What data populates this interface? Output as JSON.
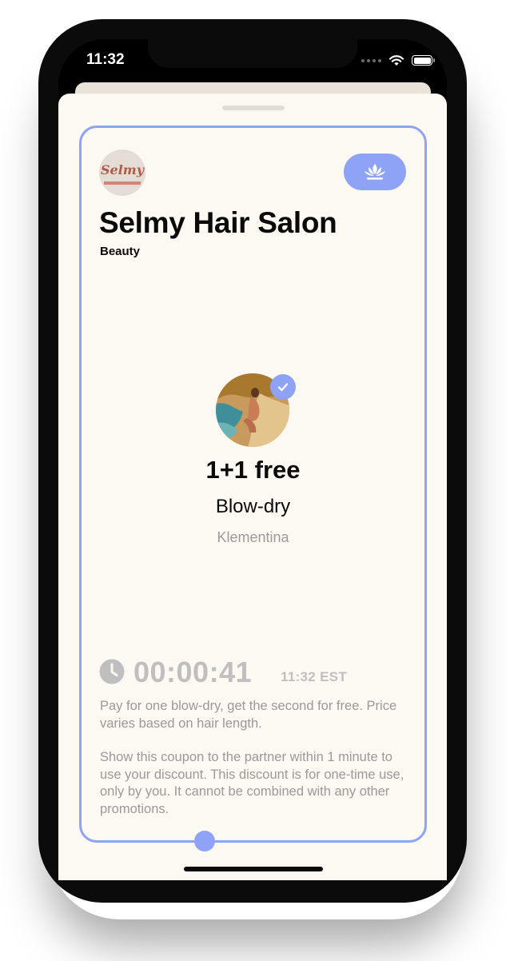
{
  "status_bar": {
    "time": "11:32",
    "icons": [
      "cellular-signal-icon",
      "wifi-icon",
      "battery-icon"
    ]
  },
  "partner": {
    "name": "Selmy Hair Salon",
    "category": "Beauty",
    "logo_text": "Selmy",
    "action_icon": "lotus-icon"
  },
  "offer": {
    "title": "1+1 free",
    "service": "Blow-dry",
    "provider": "Klementina",
    "verified_icon": "checkmark-icon"
  },
  "timer": {
    "countdown": "00:00:41",
    "timezone_time": "11:32 EST",
    "icon": "clock-icon"
  },
  "description": "Pay for one blow-dry, get the second for free. Price varies based on hair length.",
  "terms": "Show this coupon to the partner within 1 minute to use your discount. This discount is for one-time use, only by you. It cannot be combined with any other promotions.",
  "colors": {
    "accent": "#8ea3f6",
    "sheet_background": "#fcf8f2",
    "muted_text": "#9a9a9a",
    "timer_text": "#bfbfbf"
  }
}
